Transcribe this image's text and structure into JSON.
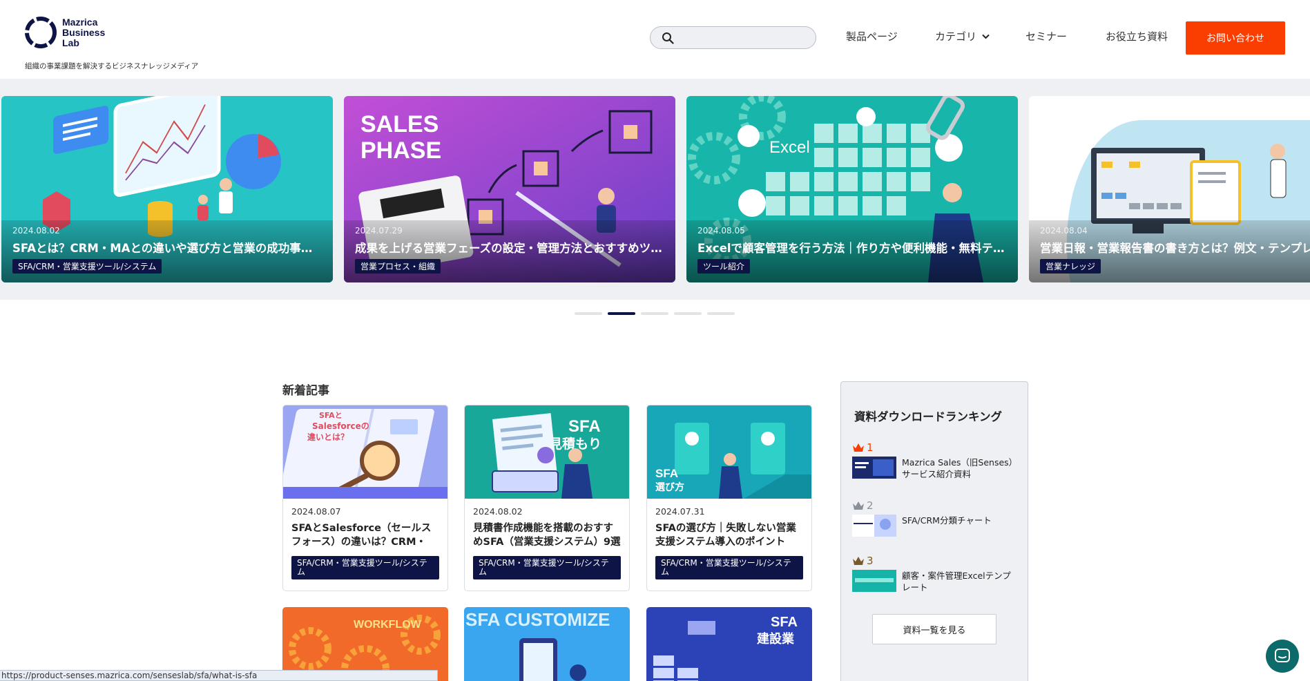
{
  "brand": {
    "name_line1": "Mazrica",
    "name_line2": "Business",
    "name_line3": "Lab",
    "tagline": "組織の事業課題を解決するビジネスナレッジメディア",
    "navy": "#0e1446",
    "accent": "#fa3d00"
  },
  "header": {
    "search_placeholder": "",
    "search_icon": "search-icon",
    "nav": {
      "products": "製品ページ",
      "category": "カテゴリ",
      "seminar": "セミナー",
      "docs": "お役立ち資料"
    },
    "contact_label": "お問い合わせ"
  },
  "carousel": {
    "slides": [
      {
        "date": "2024.08.02",
        "title": "SFAとは？CRM・MAとの違いや選び方と営業の成功事例をご紹介",
        "tag": "SFA/CRM・営業支援ツール/システム",
        "color": "#22c0c3"
      },
      {
        "date": "2024.07.29",
        "title": "成果を上げる営業フェーズの設定・管理方法とおすすめツール",
        "tag": "営業プロセス・組織",
        "color": "#b04fd3",
        "art_text_1": "SALES",
        "art_text_2": "PHASE"
      },
      {
        "date": "2024.08.05",
        "title": "Excelで顧客管理を行う方法｜作り方や便利機能・無料テンプレート",
        "tag": "ツール紹介",
        "color": "#16b3a8",
        "art_text_1": "Excel"
      },
      {
        "date": "2024.08.04",
        "title": "営業日報・営業報告書の書き方とは？例文・テンプレート",
        "tag": "営業ナレッジ",
        "color": "#b8e2f2"
      }
    ],
    "active_index": 1,
    "dot_count": 5
  },
  "main": {
    "section_title": "新着記事",
    "cards": [
      {
        "date": "2024.08.07",
        "title": "SFAとSalesforce（セールスフォース）の違いは？CRM・MAとの比較",
        "tag": "SFA/CRM・営業支援ツール/システム",
        "art_text_1": "SFAと",
        "art_text_2": "Salesforceの",
        "art_text_3": "違いとは？"
      },
      {
        "date": "2024.08.02",
        "title": "見積書作成機能を搭載のおすすめSFA（営業支援システム）9選",
        "tag": "SFA/CRM・営業支援ツール/システム",
        "art_text_1": "SFA",
        "art_text_2": "見積もり"
      },
      {
        "date": "2024.07.31",
        "title": "SFAの選び方｜失敗しない営業支援システム導入のポイント",
        "tag": "SFA/CRM・営業支援ツール/システム",
        "art_text_1": "SFA",
        "art_text_2": "選び方"
      }
    ],
    "cards_row2": [
      {
        "art_text_1": "WORKFLOW"
      },
      {
        "art_text_1": "SFA CUSTOMIZE"
      },
      {
        "art_text_1": "SFA",
        "art_text_2": "建設業"
      }
    ]
  },
  "sidebar": {
    "title": "資料ダウンロードランキング",
    "ranks": [
      {
        "num": "1",
        "label": "Mazrica Sales（旧Senses）サービス紹介資料",
        "crown_color": "#fa3d00"
      },
      {
        "num": "2",
        "label": "SFA/CRM分類チャート",
        "crown_color": "#8a8f99"
      },
      {
        "num": "3",
        "label": "顧客・案件管理Excelテンプレート",
        "crown_color": "#7a5a2a"
      }
    ],
    "list_button": "資料一覧を見る"
  },
  "status_url": "https://product-senses.mazrica.com/senseslab/sfa/what-is-sfa"
}
